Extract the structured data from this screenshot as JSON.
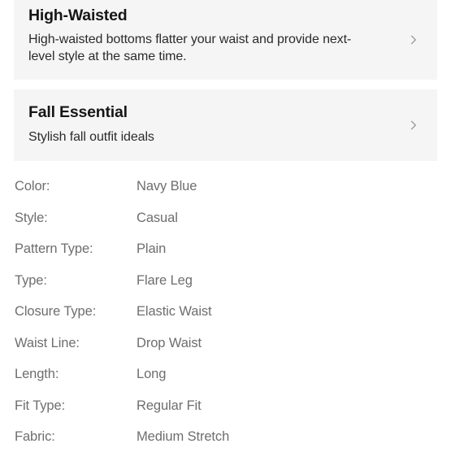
{
  "promo_cards": [
    {
      "title": "High-Waisted",
      "description": "High-waisted bottoms flatter your waist and provide next-level style at the same time.",
      "chevron_icon": "chevron-right-icon"
    },
    {
      "title": "Fall Essential",
      "description": "Stylish fall outfit ideals",
      "chevron_icon": "chevron-right-icon"
    }
  ],
  "attributes": [
    {
      "label": "Color:",
      "value": "Navy Blue"
    },
    {
      "label": "Style:",
      "value": "Casual"
    },
    {
      "label": "Pattern Type:",
      "value": "Plain"
    },
    {
      "label": "Type:",
      "value": "Flare Leg"
    },
    {
      "label": "Closure Type:",
      "value": "Elastic Waist"
    },
    {
      "label": "Waist Line:",
      "value": "Drop Waist"
    },
    {
      "label": "Length:",
      "value": "Long"
    },
    {
      "label": "Fit Type:",
      "value": "Regular Fit"
    },
    {
      "label": "Fabric:",
      "value": "Medium Stretch"
    }
  ],
  "colors": {
    "card_background": "#f5f5f5",
    "page_background": "#ffffff",
    "title_text": "#161616",
    "body_text": "#2b2b2b",
    "attribute_text": "#6e6e6e",
    "chevron": "#9a9a9a"
  }
}
